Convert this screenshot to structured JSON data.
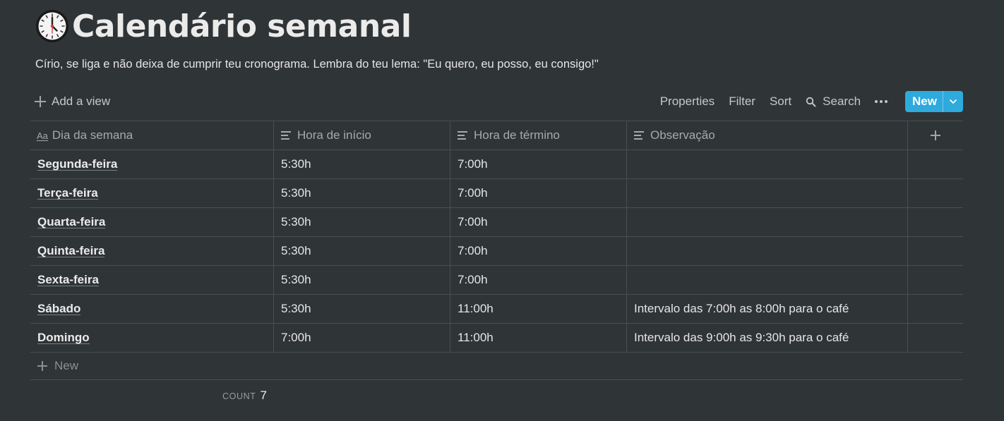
{
  "page": {
    "title": "Calendário semanal",
    "icon": "clock-icon",
    "description": "Círio, se liga e não deixa de cumprir teu cronograma. Lembra do teu lema: \"Eu quero, eu posso, eu consigo!\""
  },
  "toolbar": {
    "add_view": "Add a view",
    "properties": "Properties",
    "filter": "Filter",
    "sort": "Sort",
    "search": "Search",
    "new": "New",
    "accent_color": "#2eaadc"
  },
  "table": {
    "columns": [
      {
        "label": "Dia da semana",
        "icon": "Aa"
      },
      {
        "label": "Hora de início",
        "icon": "text-lines-icon"
      },
      {
        "label": "Hora de término",
        "icon": "text-lines-icon"
      },
      {
        "label": "Observação",
        "icon": "text-lines-icon"
      }
    ],
    "rows": [
      {
        "dia": "Segunda-feira",
        "inicio": "5:30h",
        "termino": "7:00h",
        "obs": ""
      },
      {
        "dia": "Terça-feira",
        "inicio": "5:30h",
        "termino": "7:00h",
        "obs": ""
      },
      {
        "dia": "Quarta-feira",
        "inicio": "5:30h",
        "termino": "7:00h",
        "obs": ""
      },
      {
        "dia": "Quinta-feira",
        "inicio": "5:30h",
        "termino": "7:00h",
        "obs": ""
      },
      {
        "dia": "Sexta-feira",
        "inicio": "5:30h",
        "termino": "7:00h",
        "obs": ""
      },
      {
        "dia": "Sábado",
        "inicio": "5:30h",
        "termino": "11:00h",
        "obs": "Intervalo das 7:00h as 8:00h para o café"
      },
      {
        "dia": "Domingo",
        "inicio": "7:00h",
        "termino": "11:00h",
        "obs": "Intervalo das 9:00h as 9:30h para o café"
      }
    ],
    "new_row_label": "New",
    "count_label": "COUNT",
    "count_value": "7"
  }
}
